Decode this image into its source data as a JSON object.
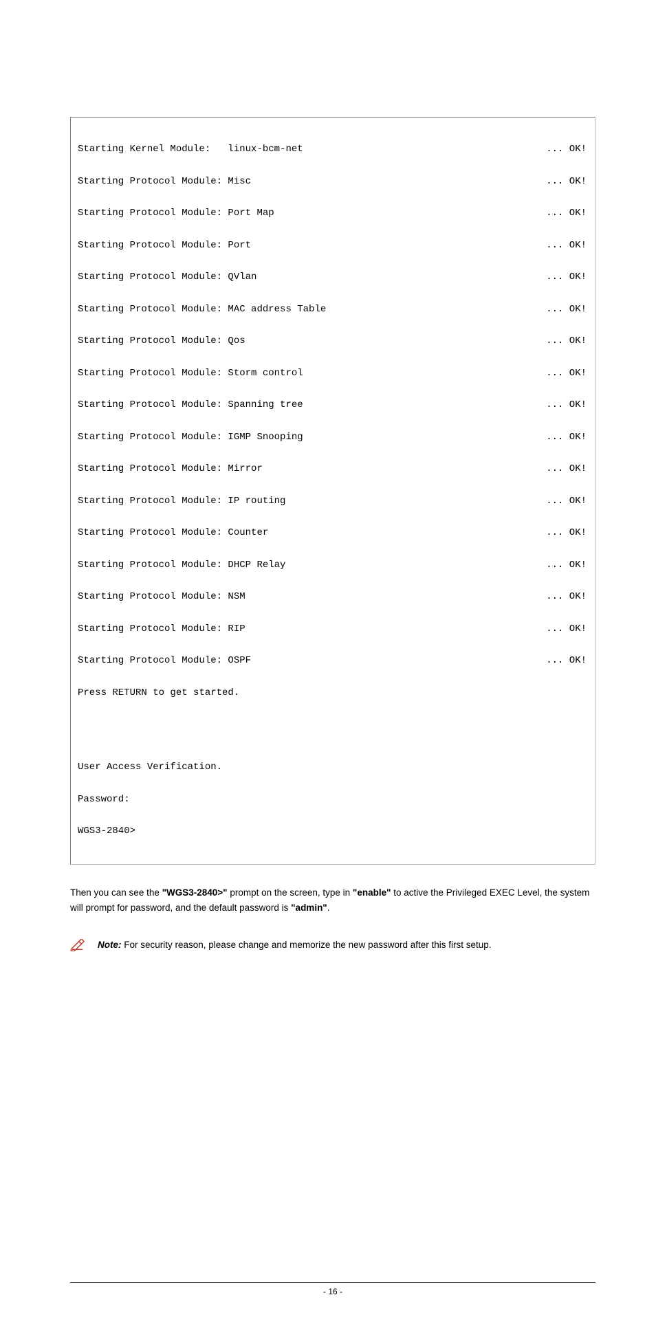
{
  "terminal": {
    "lines": [
      {
        "lhs": "Starting Kernel Module:   linux-bcm-net",
        "rhs": "... OK!"
      },
      {
        "lhs": "Starting Protocol Module: Misc",
        "rhs": "... OK!"
      },
      {
        "lhs": "Starting Protocol Module: Port Map",
        "rhs": "... OK!"
      },
      {
        "lhs": "Starting Protocol Module: Port",
        "rhs": "... OK!"
      },
      {
        "lhs": "Starting Protocol Module: QVlan",
        "rhs": "... OK!"
      },
      {
        "lhs": "Starting Protocol Module: MAC address Table",
        "rhs": "... OK!"
      },
      {
        "lhs": "Starting Protocol Module: Qos",
        "rhs": "... OK!"
      },
      {
        "lhs": "Starting Protocol Module: Storm control",
        "rhs": "... OK!"
      },
      {
        "lhs": "Starting Protocol Module: Spanning tree",
        "rhs": "... OK!"
      },
      {
        "lhs": "Starting Protocol Module: IGMP Snooping",
        "rhs": "... OK!"
      },
      {
        "lhs": "Starting Protocol Module: Mirror",
        "rhs": "... OK!"
      },
      {
        "lhs": "Starting Protocol Module: IP routing",
        "rhs": "... OK!"
      },
      {
        "lhs": "Starting Protocol Module: Counter",
        "rhs": "... OK!"
      },
      {
        "lhs": "Starting Protocol Module: DHCP Relay",
        "rhs": "... OK!"
      },
      {
        "lhs": "Starting Protocol Module: NSM",
        "rhs": "... OK!"
      },
      {
        "lhs": "Starting Protocol Module: RIP",
        "rhs": "... OK!"
      },
      {
        "lhs": "Starting Protocol Module: OSPF",
        "rhs": "... OK!"
      }
    ],
    "press_return": "Press RETURN to get started.",
    "blank": "",
    "uav": "User Access Verification.",
    "password": "Password:",
    "prompt": "WGS3-2840>"
  },
  "body": {
    "p1_a": "Then you can see the ",
    "p1_b": "\"WGS3-2840>\"",
    "p1_c": " prompt on the screen, type in ",
    "p1_d": "\"enable\"",
    "p1_e": " to active the Privileged EXEC Level, the system will prompt for password, and the default password is ",
    "p1_f": "\"admin\"",
    "p1_g": "."
  },
  "note": {
    "label": "Note:",
    "text": " For security reason, please change and memorize the new password after this first setup."
  },
  "footer": {
    "page_num": "- 16 -"
  }
}
